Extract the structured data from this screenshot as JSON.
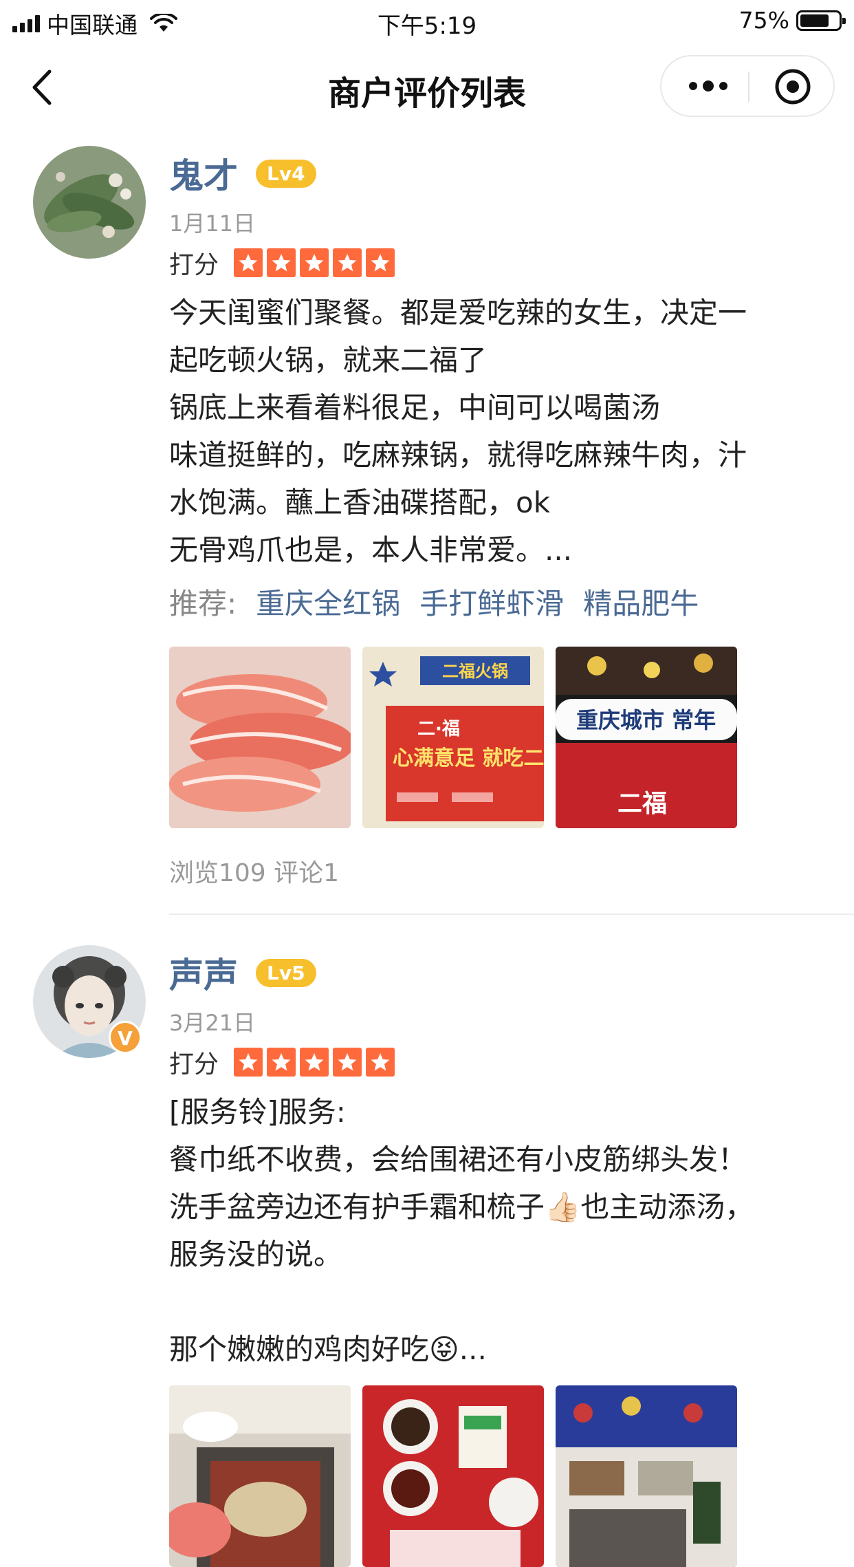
{
  "status_bar": {
    "carrier": "中国联通",
    "time": "下午5:19",
    "battery_percent": "75%",
    "battery_level": 0.75
  },
  "nav": {
    "title": "商户评价列表",
    "back_icon": "chevron-left-icon",
    "more_icon": "more-dots-icon",
    "close_icon": "target-icon"
  },
  "reviews": [
    {
      "user": "鬼才",
      "level": "Lv4",
      "date": "1月11日",
      "rating_label": "打分",
      "stars": 5,
      "text_lines": [
        "今天闺蜜们聚餐。都是爱吃辣的女生，决定一",
        "起吃顿火锅，就来二福了",
        "锅底上来看着料很足，中间可以喝菌汤",
        "味道挺鲜的，吃麻辣锅，就得吃麻辣牛肉，汁",
        "水饱满。蘸上香油碟搭配，ok",
        "无骨鸡爪也是，本人非常爱。..."
      ],
      "recommend_label": "推荐:",
      "recommend_tags": [
        "重庆全红锅",
        "手打鲜虾滑",
        "精品肥牛"
      ],
      "photo_captions": [
        "二福火锅",
        "二·福",
        "心满意足 就吃二",
        "重庆城市 常年",
        "二福"
      ],
      "stats": "浏览109 评论1"
    },
    {
      "user": "声声",
      "level": "Lv5",
      "verified_badge": "V",
      "date": "3月21日",
      "rating_label": "打分",
      "stars": 5,
      "text_lines": [
        "[服务铃]服务:",
        "餐巾纸不收费，会给围裙还有小皮筋绑头发！",
        "洗手盆旁边还有护手霜和梳子👍🏻也主动添汤，",
        "服务没的说。",
        "",
        "那个嫩嫩的鸡肉好吃😝..."
      ]
    }
  ],
  "colors": {
    "name": "#4a6a94",
    "level_badge": "#f7bf2b",
    "star": "#ff6a3d",
    "muted": "#999999",
    "verified": "#f5a03a"
  }
}
